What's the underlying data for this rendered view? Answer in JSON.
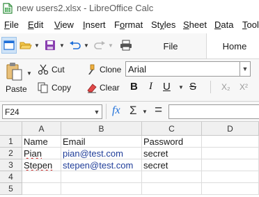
{
  "window": {
    "title": "new users2.xlsx - LibreOffice Calc"
  },
  "menu": [
    {
      "key": "file",
      "label": "File",
      "mnemonic": "F",
      "rest": "ile"
    },
    {
      "key": "edit",
      "label": "Edit",
      "mnemonic": "E",
      "rest": "dit"
    },
    {
      "key": "view",
      "label": "View",
      "mnemonic": "V",
      "rest": "iew"
    },
    {
      "key": "insert",
      "label": "Insert",
      "mnemonic": "I",
      "rest": "nsert"
    },
    {
      "key": "format",
      "label": "Format",
      "mnemonic": "o",
      "pre": "F",
      "rest": "rmat"
    },
    {
      "key": "styles",
      "label": "Styles",
      "mnemonic": "y",
      "pre": "St",
      "rest": "les"
    },
    {
      "key": "sheet",
      "label": "Sheet",
      "mnemonic": "S",
      "rest": "heet"
    },
    {
      "key": "data",
      "label": "Data",
      "mnemonic": "D",
      "rest": "ata"
    },
    {
      "key": "tools",
      "label": "Tools",
      "mnemonic": "T",
      "rest": "ools"
    }
  ],
  "tabs": {
    "file": "File",
    "home": "Home"
  },
  "ribbon": {
    "paste": "Paste",
    "cut": "Cut",
    "copy": "Copy",
    "clone": "Clone",
    "clear": "Clear",
    "font_name": "Arial",
    "bold": "B",
    "italic": "I",
    "underline": "U",
    "strike": "S",
    "subscript": "X₂",
    "superscript": "X²"
  },
  "formula_bar": {
    "cell_ref": "F24",
    "fx": "fx",
    "sigma": "Σ",
    "equals": "=",
    "content": ""
  },
  "sheet": {
    "columns": [
      "A",
      "B",
      "C",
      "D"
    ],
    "rows": [
      "1",
      "2",
      "3",
      "4",
      "5"
    ],
    "cells": {
      "A1": "Name",
      "B1": "Email",
      "C1": "Password",
      "A2": "Pian",
      "B2": "pian@test.com",
      "C2": "secret",
      "A3": "Stepen",
      "B3": "stepen@test.com",
      "C3": "secret"
    }
  },
  "colors": {
    "link": "#1f3d99",
    "accent": "#1e6fd9",
    "spell": "#d02020"
  }
}
